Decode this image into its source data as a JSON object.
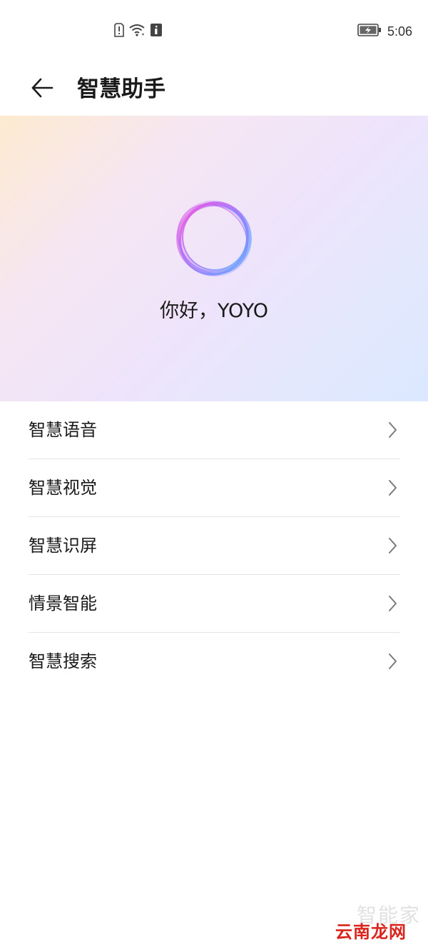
{
  "status_bar": {
    "time": "5:06",
    "icons": [
      "sim-alert-icon",
      "wifi-icon",
      "info-icon",
      "battery-charging-icon"
    ]
  },
  "header": {
    "title": "智慧助手",
    "back_icon": "arrow-left-icon"
  },
  "hero": {
    "greeting": "你好，YOYO",
    "orb_colors": [
      "#ff4fd8",
      "#9a6bff",
      "#4fb3ff"
    ]
  },
  "menu": {
    "items": [
      {
        "label": "智慧语音"
      },
      {
        "label": "智慧视觉"
      },
      {
        "label": "智慧识屏"
      },
      {
        "label": "情景智能"
      },
      {
        "label": "智慧搜索"
      }
    ]
  },
  "watermark": {
    "faint_text": "智能家",
    "logo_text": "云南龙网"
  }
}
